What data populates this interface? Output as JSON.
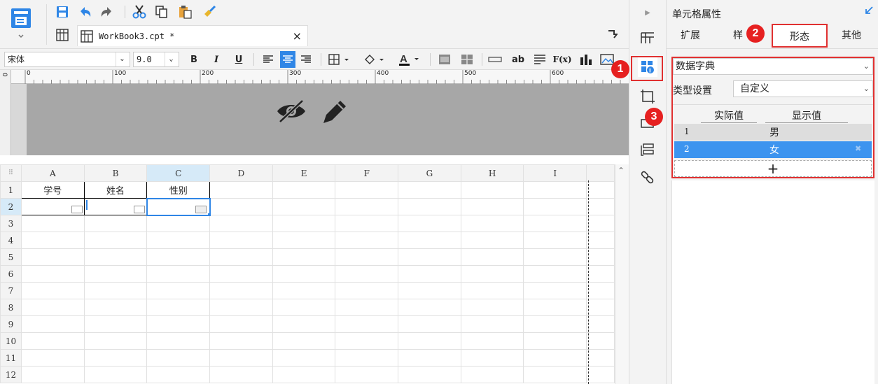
{
  "file_tab": {
    "name": "WorkBook3.cpt *",
    "close": "×"
  },
  "format": {
    "font": "宋体",
    "size": "9.0",
    "bold": "B",
    "italic": "I",
    "underline": "U",
    "text_tool": "ab",
    "formula": "F(x)",
    "font_color_letter": "A"
  },
  "ruler": {
    "ticks": [
      "0",
      "100",
      "200",
      "300",
      "400",
      "500",
      "600"
    ],
    "side": "0"
  },
  "grid": {
    "corner": "⠿",
    "columns": [
      "A",
      "B",
      "C",
      "D",
      "E",
      "F",
      "G",
      "H",
      "I"
    ],
    "rows": [
      "1",
      "2",
      "3",
      "4",
      "5",
      "6",
      "7",
      "8",
      "9",
      "10",
      "11",
      "12"
    ],
    "cells": {
      "A1": "学号",
      "B1": "姓名",
      "C1": "性别"
    }
  },
  "right_panel": {
    "title": "单元格属性",
    "tabs": [
      "扩展",
      "样",
      "形态",
      "其他"
    ],
    "widget_type": "数据字典",
    "type_setting_label": "类型设置",
    "type_setting_value": "自定义",
    "table_headers": [
      "实际值",
      "显示值"
    ],
    "rows": [
      {
        "actual": "1",
        "display": "男"
      },
      {
        "actual": "2",
        "display": "女"
      }
    ],
    "add_label": "+"
  },
  "badges": [
    "1",
    "2",
    "3"
  ],
  "colors": {
    "accent": "#2f86e6",
    "highlight": "#e03030",
    "selected_row": "#3d94ef"
  }
}
